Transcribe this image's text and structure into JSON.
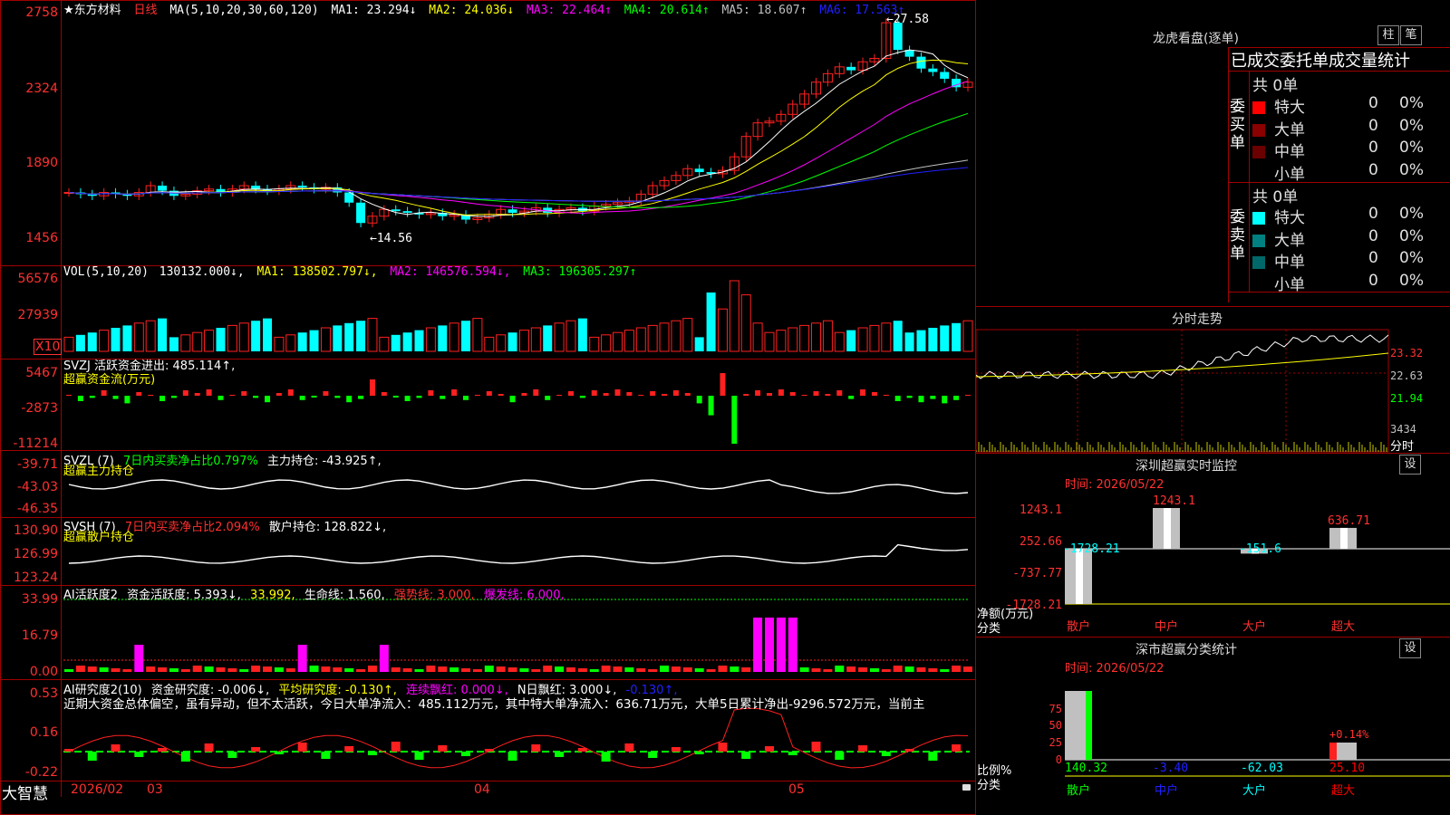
{
  "header": {
    "stock_name": "★东方材料",
    "period": "日线",
    "ma_params": "MA(5,10,20,30,60,120)",
    "ma": [
      {
        "label": "MA1: 23.294↓",
        "color": "#ffffff"
      },
      {
        "label": "MA2: 24.036↓",
        "color": "#ffff00"
      },
      {
        "label": "MA3: 22.464↑",
        "color": "#ff00ff"
      },
      {
        "label": "MA4: 20.614↑",
        "color": "#00ff00"
      },
      {
        "label": "MA5: 18.607↑",
        "color": "#c0c0c0"
      },
      {
        "label": "MA6: 17.563↑",
        "color": "#2020ff"
      }
    ],
    "high_mark": "←27.58",
    "low_mark": "←14.56"
  },
  "price_axis": [
    "2758",
    "2324",
    "1890",
    "1456"
  ],
  "vol": {
    "label": "VOL(5,10,20)",
    "value": "130132.000↓,",
    "ma1": "MA1: 138502.797↓,",
    "ma2": "MA2: 146576.594↓,",
    "ma3": "MA3: 196305.297↑",
    "axis": [
      "56576",
      "27939",
      "X10"
    ]
  },
  "svzj": {
    "label": "SVZJ  活跃资金进出: 485.114↑,",
    "sub": "超赢资金流(万元)",
    "axis": [
      "5467",
      "-2873",
      "-11214"
    ]
  },
  "svzl": {
    "label": "SVZL (7)",
    "desc": "7日内买卖净占比0.797%",
    "hold": "主力持仓: -43.925↑,",
    "sub": "超赢主力持仓",
    "axis": [
      "-39.71",
      "-43.03",
      "-46.35"
    ]
  },
  "svsh": {
    "label": "SVSH (7)",
    "desc": "7日内买卖净占比2.094%",
    "hold": "散户持仓: 128.822↓,",
    "sub": "超赢散户持仓",
    "axis": [
      "130.90",
      "126.99",
      "123.24"
    ]
  },
  "ai_active": {
    "label": "AI活跃度2",
    "l1": "资金活跃度: 5.393↓,",
    "l2": "33.992,",
    "l3": "生命线: 1.560,",
    "l4": "强势线: 3.000,",
    "l5": "爆发线: 6.000,",
    "axis": [
      "33.99",
      "16.79",
      "0.00"
    ]
  },
  "ai_research": {
    "label": "AI研究度2(10)",
    "l1": "资金研究度: -0.006↓,",
    "l2": "平均研究度: -0.130↑,",
    "l3": "连续飘红: 0.000↓,",
    "l4": "N日飘红: 3.000↓,",
    "l5": "-0.130↑,",
    "comment": "近期大资金总体偏空，虽有异动，但不太活跃，今日大单净流入：485.112万元，其中特大单净流入：636.71万元，大单5日累计净出-9296.572万元，当前主",
    "axis": [
      "0.53",
      "0.16",
      "-0.22"
    ]
  },
  "bottom": {
    "brand": "大智慧",
    "dates": [
      "2026/02",
      "03",
      "04",
      "05"
    ]
  },
  "right": {
    "lhb_title": "龙虎看盘(逐单)",
    "btn_bar": "柱",
    "btn_pen": "笔",
    "tabs": "已成交委托单成交量统计",
    "buy_side_label": "委买单",
    "sell_side_label": "委卖单",
    "buy_total": "共 0单",
    "sell_total": "共 0单",
    "buy_rows": [
      {
        "name": "特大",
        "count": "0",
        "pct": "0%",
        "color": "#ff0000"
      },
      {
        "name": "大单",
        "count": "0",
        "pct": "0%",
        "color": "#8b0000"
      },
      {
        "name": "中单",
        "count": "0",
        "pct": "0%",
        "color": "#6b0000"
      },
      {
        "name": "小单",
        "count": "0",
        "pct": "0%",
        "color": "#000000"
      }
    ],
    "sell_rows": [
      {
        "name": "特大",
        "count": "0",
        "pct": "0%",
        "color": "#00ffff"
      },
      {
        "name": "大单",
        "count": "0",
        "pct": "0%",
        "color": "#008080"
      },
      {
        "name": "中单",
        "count": "0",
        "pct": "0%",
        "color": "#006868"
      },
      {
        "name": "小单",
        "count": "0",
        "pct": "0%",
        "color": "#000000"
      }
    ],
    "fenshi_title": "分时走势",
    "fenshi_axis": [
      "23.32",
      "22.63",
      "21.94",
      "3434",
      "分时"
    ],
    "sz_monitor_title": "深圳超赢实时监控",
    "sz_date": "时间: 2026/05/22",
    "sz_btn": "设",
    "sz_axis": [
      "1243.1",
      "252.66",
      "-737.77",
      "-1728.21"
    ],
    "sz_axis_label1": "净额(万元)",
    "sz_axis_label2": "分类",
    "sz_bars": [
      {
        "name": "散户",
        "value": "-1728.21",
        "num": -1728.21
      },
      {
        "name": "中户",
        "value": "1243.1",
        "num": 1243.1
      },
      {
        "name": "大户",
        "value": "-151.6",
        "num": -151.6
      },
      {
        "name": "超大",
        "value": "636.71",
        "num": 636.71
      }
    ],
    "cat_title": "深市超赢分类统计",
    "cat_date": "时间: 2026/05/22",
    "cat_btn": "设",
    "cat_axis": [
      "75",
      "50",
      "25",
      "0"
    ],
    "cat_axis_label1": "比例%",
    "cat_axis_label2": "分类",
    "cat_bars": [
      {
        "name": "散户",
        "value": "140.32",
        "color": "#00ff00"
      },
      {
        "name": "中户",
        "value": "-3.40",
        "color": "#2020ff"
      },
      {
        "name": "大户",
        "value": "-62.03",
        "color": "#00ffff"
      },
      {
        "name": "超大",
        "value": "25.10",
        "color": "#ff0000",
        "top": "+0.14%"
      }
    ]
  }
}
